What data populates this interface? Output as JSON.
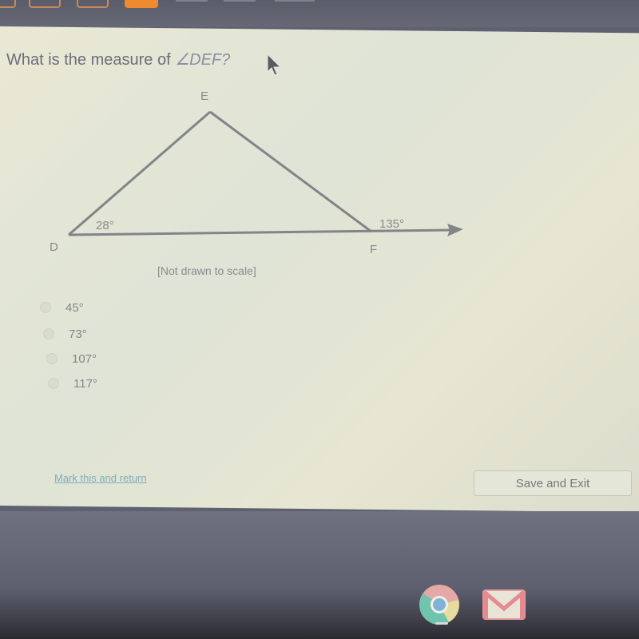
{
  "question": {
    "prefix": "What is the measure of ",
    "angle": "∠DEF?"
  },
  "diagram": {
    "vertices": {
      "D": "D",
      "E": "E",
      "F": "F"
    },
    "angle_labels": {
      "at_D": "28°",
      "exterior_at_F": "135°"
    },
    "note": "[Not drawn to scale]"
  },
  "options": [
    {
      "label": "45°"
    },
    {
      "label": "73°"
    },
    {
      "label": "107°"
    },
    {
      "label": "117°"
    }
  ],
  "footer": {
    "mark_link": "Mark this and return",
    "save_button": "Save and Exit"
  },
  "dock": {
    "apps": [
      "chrome-icon",
      "gmail-icon"
    ]
  },
  "colors": {
    "accent_tab": "#f08a30",
    "link": "#7eaeb8"
  }
}
